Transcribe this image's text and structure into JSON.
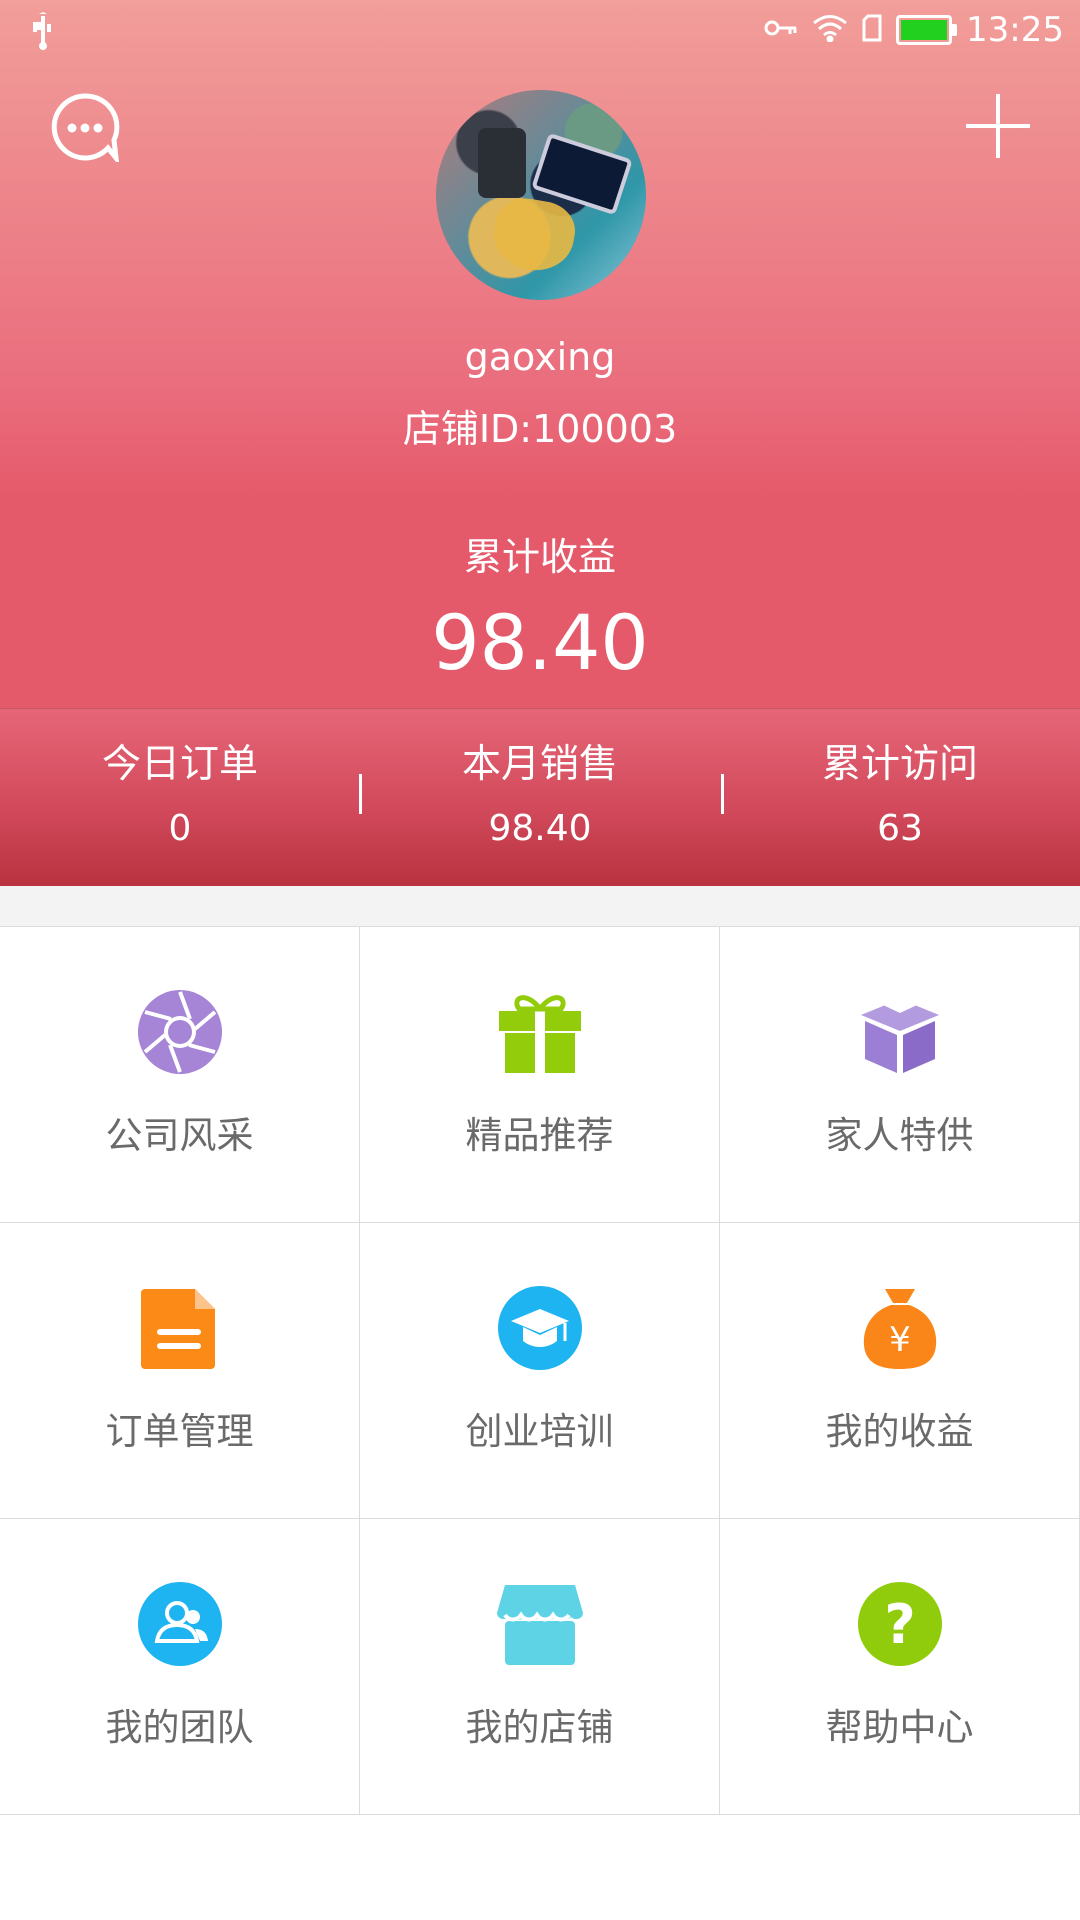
{
  "status_bar": {
    "time": "13:25"
  },
  "header": {
    "username": "gaoxing",
    "store_id": "店铺ID:100003",
    "earnings_label": "累计收益",
    "earnings_value": "98.40"
  },
  "stats": [
    {
      "label": "今日订单",
      "value": "0"
    },
    {
      "label": "本月销售",
      "value": "98.40"
    },
    {
      "label": "累计访问",
      "value": "63"
    }
  ],
  "grid": [
    {
      "label": "公司风采",
      "icon": "aperture-icon",
      "color": "#a684d6"
    },
    {
      "label": "精品推荐",
      "icon": "gift-icon",
      "color": "#92cc0a"
    },
    {
      "label": "家人特供",
      "icon": "box-icon",
      "color": "#9b7fd4"
    },
    {
      "label": "订单管理",
      "icon": "document-icon",
      "color": "#fb8a16"
    },
    {
      "label": "创业培训",
      "icon": "graduation-cap-icon",
      "color": "#1db4f1"
    },
    {
      "label": "我的收益",
      "icon": "money-bag-icon",
      "color": "#fa8518"
    },
    {
      "label": "我的团队",
      "icon": "team-icon",
      "color": "#1db4f1"
    },
    {
      "label": "我的店铺",
      "icon": "store-icon",
      "color": "#5fd3e6"
    },
    {
      "label": "帮助中心",
      "icon": "help-icon",
      "color": "#90cc0b"
    }
  ]
}
